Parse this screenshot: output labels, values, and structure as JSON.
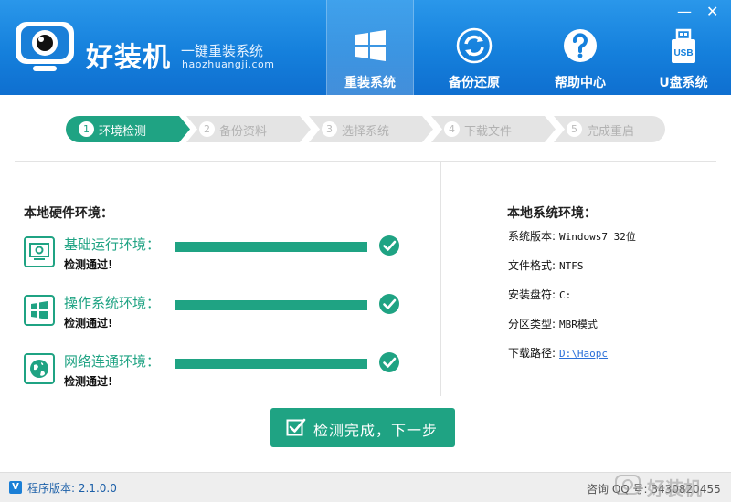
{
  "app": {
    "brand": "好装机",
    "slogan": "一键重装系统",
    "domain": "haozhuangji.com"
  },
  "window_controls": {
    "minimize": "—",
    "close": "✕"
  },
  "nav": [
    {
      "label": "重装系统",
      "icon": "windows-logo-icon",
      "active": true
    },
    {
      "label": "备份还原",
      "icon": "backup-restore-icon",
      "active": false
    },
    {
      "label": "帮助中心",
      "icon": "help-icon",
      "active": false
    },
    {
      "label": "U盘系统",
      "icon": "usb-icon",
      "active": false
    }
  ],
  "usb_icon_text": "USB",
  "steps": [
    {
      "num": "1",
      "label": "环境检测",
      "active": true
    },
    {
      "num": "2",
      "label": "备份资料",
      "active": false
    },
    {
      "num": "3",
      "label": "选择系统",
      "active": false
    },
    {
      "num": "4",
      "label": "下载文件",
      "active": false
    },
    {
      "num": "5",
      "label": "完成重启",
      "active": false
    }
  ],
  "hardware": {
    "title": "本地硬件环境：",
    "checks": [
      {
        "label": "基础运行环境：",
        "status": "检测通过!",
        "progress": 1.0,
        "icon": "monitor-gear-icon"
      },
      {
        "label": "操作系统环境：",
        "status": "检测通过!",
        "progress": 1.0,
        "icon": "windows-logo-icon"
      },
      {
        "label": "网络连通环境：",
        "status": "检测通过!",
        "progress": 1.0,
        "icon": "globe-icon"
      }
    ]
  },
  "system": {
    "title": "本地系统环境：",
    "rows": [
      {
        "key": "系统版本:",
        "value": "Windows7  32位"
      },
      {
        "key": "文件格式:",
        "value": "NTFS"
      },
      {
        "key": "安装盘符:",
        "value": "C:"
      },
      {
        "key": "分区类型:",
        "value": "MBR模式"
      },
      {
        "key": "下载路径:",
        "value": "D:\\Haopc",
        "link": true
      }
    ]
  },
  "primary_button": "检测完成，下一步",
  "footer": {
    "badge": "V",
    "version": "程序版本: 2.1.0.0",
    "qq": "咨询 QQ 号: 3430820455",
    "watermark": "好装机"
  },
  "colors": {
    "header_blue": "#1580dc",
    "accent_green": "#1fa383",
    "inactive_step": "#e4e4e4"
  }
}
